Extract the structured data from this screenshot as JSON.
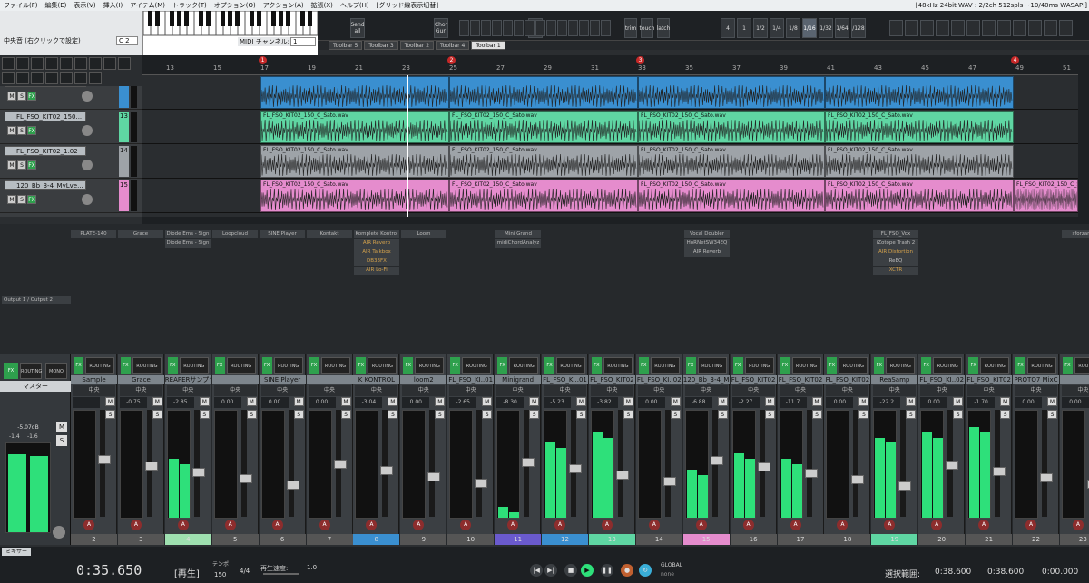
{
  "menu": {
    "items": [
      "ファイル(F)",
      "編集(E)",
      "表示(V)",
      "挿入(I)",
      "アイテム(M)",
      "トラック(T)",
      "オプション(O)",
      "アクション(A)",
      "拡張(X)",
      "ヘルプ(H)",
      "[グリッド線表示切替]"
    ],
    "status": "[48kHz 24bit WAV : 2/2ch 512spls ~10/40ms WASAPI]"
  },
  "topleft": {
    "label": "中央音 (右クリックで設定)",
    "value": "C 2",
    "midi_label": "MIDI チャンネル:",
    "midi_value": "1"
  },
  "toolbar": {
    "buttons": [
      "Send all",
      "Chor Gun",
      "trim",
      "touch",
      "latch",
      "View FX",
      "4",
      "1",
      "1/2",
      "1/4",
      "1/8",
      "1/16",
      "1/32",
      "1/64",
      "/128"
    ],
    "active": "1/16"
  },
  "tabs": [
    "Toolbar 5",
    "Toolbar 3",
    "Toolbar 2",
    "Toolbar 4",
    "Toolbar 1"
  ],
  "ruler": {
    "bars": [
      "13",
      "15",
      "17",
      "19",
      "21",
      "23",
      "25",
      "27",
      "29",
      "31",
      "33",
      "35",
      "37",
      "39",
      "41",
      "43",
      "45",
      "47",
      "49",
      "51"
    ],
    "markers": [
      "1",
      "2",
      "3",
      "4"
    ]
  },
  "tracks": [
    {
      "name": "FL_FSO_KIT02_1.02",
      "num": "12",
      "color": "#3a8fd0"
    },
    {
      "name": "FL_FSO_KIT02_150...",
      "num": "13",
      "color": "#5fd6a3"
    },
    {
      "name": "FL_FSO_KIT02_1.02",
      "num": "14",
      "color": "#9ea3a8"
    },
    {
      "name": "120_Bb_3-4_MyLve...",
      "num": "15",
      "color": "#e58ccd"
    }
  ],
  "item_label": "FL_FSO_KIT02_150_C_Sato.wav",
  "fx": [
    {
      "col": 0,
      "slots": [
        {
          "t": "PLATE-140"
        }
      ]
    },
    {
      "col": 1,
      "slots": [
        {
          "t": "Grace"
        }
      ]
    },
    {
      "col": 2,
      "slots": [
        {
          "t": "Diode Ems - Sign"
        },
        {
          "t": "Diode Ems - Sign"
        }
      ]
    },
    {
      "col": 3,
      "slots": [
        {
          "t": "Loopcloud"
        }
      ]
    },
    {
      "col": 4,
      "slots": [
        {
          "t": "SINE Player"
        }
      ]
    },
    {
      "col": 5,
      "slots": [
        {
          "t": "Kontakt"
        }
      ]
    },
    {
      "col": 6,
      "slots": [
        {
          "t": "Komplete Kontrol"
        },
        {
          "t": "AIR Reverb",
          "b": true
        },
        {
          "t": "AIR Talkbox",
          "b": true
        },
        {
          "t": "DB33FX",
          "b": true
        },
        {
          "t": "AIR Lo-Fi",
          "b": true
        }
      ]
    },
    {
      "col": 7,
      "slots": [
        {
          "t": "Loom"
        }
      ]
    },
    {
      "col": 9,
      "slots": [
        {
          "t": "Mini Grand"
        },
        {
          "t": "midiChordAnalyz"
        }
      ]
    },
    {
      "col": 13,
      "slots": [
        {
          "t": "Vocal Doubler"
        },
        {
          "t": "HoRNetSW34EQ"
        },
        {
          "t": "AIR Reverb"
        }
      ]
    },
    {
      "col": 17,
      "slots": [
        {
          "t": "FL_FSO_Vox"
        },
        {
          "t": "iZotope Trash 2"
        },
        {
          "t": "AIR Distortion",
          "b": true
        },
        {
          "t": "ReEQ"
        },
        {
          "t": "XCTR",
          "b": true
        }
      ]
    },
    {
      "col": 21,
      "slots": [
        {
          "t": "sforzando"
        }
      ]
    }
  ],
  "output_label": "Output 1 / Output 2",
  "master": {
    "name": "マスター",
    "vol": "-5.07dB",
    "peakL": "-1.4",
    "peakR": "-1.6"
  },
  "strips": [
    {
      "name": "Sample",
      "vol": "",
      "num": "2",
      "color": "#555"
    },
    {
      "name": "Grace",
      "vol": "-0.75",
      "num": "3",
      "color": "#555"
    },
    {
      "name": "REAPERサンプラ",
      "vol": "-2.85",
      "num": "4",
      "color": "#9fe0b0"
    },
    {
      "name": "",
      "vol": "0.00",
      "num": "5",
      "color": "#555"
    },
    {
      "name": "SINE Player",
      "vol": "0.00",
      "num": "6",
      "color": "#555"
    },
    {
      "name": "",
      "vol": "0.00",
      "num": "7",
      "color": "#555"
    },
    {
      "name": "K KONTROL",
      "vol": "-3.04",
      "num": "8",
      "color": "#3a8fd0"
    },
    {
      "name": "loom2",
      "vol": "0.00",
      "num": "9",
      "color": "#555"
    },
    {
      "name": "FL_FSO_KI..01",
      "vol": "-2.65",
      "num": "10",
      "color": "#555"
    },
    {
      "name": "Minigrand",
      "vol": "-8.30",
      "num": "11",
      "color": "#6a5acd"
    },
    {
      "name": "FL_FSO_KI..01",
      "vol": "-5.23",
      "num": "12",
      "color": "#3a8fd0"
    },
    {
      "name": "FL_FSO_KIT02",
      "vol": "-3.82",
      "num": "13",
      "color": "#5fd6a3"
    },
    {
      "name": "FL_FSO_KI..02",
      "vol": "0.00",
      "num": "14",
      "color": "#555"
    },
    {
      "name": "120_Bb_3-4_M",
      "vol": "-6.88",
      "num": "15",
      "color": "#e58ccd"
    },
    {
      "name": "FL_FSO_KIT02",
      "vol": "-2.27",
      "num": "16",
      "color": "#555"
    },
    {
      "name": "FL_FSO_KIT02",
      "vol": "-11.7",
      "num": "17",
      "color": "#555"
    },
    {
      "name": "FL_FSO_KIT02",
      "vol": "0.00",
      "num": "18",
      "color": "#555"
    },
    {
      "name": "ReaSamp",
      "vol": "-22.2",
      "num": "19",
      "color": "#5fd6a3"
    },
    {
      "name": "FL_FSO_KI..02",
      "vol": "0.00",
      "num": "20",
      "color": "#555"
    },
    {
      "name": "FL_FSO_KIT02",
      "vol": "-1.70",
      "num": "21",
      "color": "#555"
    },
    {
      "name": "PROTO7 MixC",
      "vol": "0.00",
      "num": "22",
      "color": "#555"
    },
    {
      "name": "",
      "vol": "0.00",
      "num": "23",
      "color": "#555"
    }
  ],
  "meters": [
    0,
    0,
    55,
    0,
    0,
    0,
    0,
    0,
    0,
    10,
    70,
    80,
    0,
    45,
    60,
    55,
    0,
    75,
    80,
    85,
    0,
    0
  ],
  "mixer_tab": "ミキサー",
  "transport": {
    "time": "0:35.650",
    "state": "[再生]",
    "tempo_label": "テンポ",
    "tempo": "150",
    "sig": "4/4",
    "rate_label": "再生速度:",
    "rate": "1.0",
    "sel_label": "選択範囲:",
    "sel_start": "0:38.600",
    "sel_end": "0:38.600",
    "sel_len": "0:00.000",
    "global": "GLOBAL",
    "global_sub": "none"
  }
}
